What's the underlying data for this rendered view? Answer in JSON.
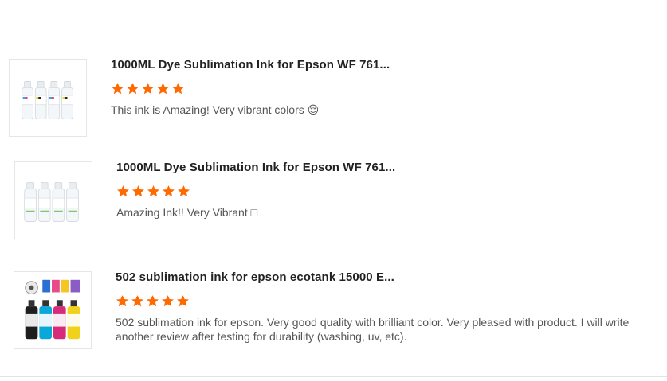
{
  "reviews": [
    {
      "title": "1000ML Dye Sublimation Ink for Epson WF 761...",
      "rating": 5,
      "text": "This ink is Amazing! Very vibrant colors 😌",
      "thumbnail": "four-white-ink-bottles"
    },
    {
      "title": "1000ML Dye Sublimation Ink for Epson WF 761...",
      "rating": 5,
      "text": "Amazing Ink!! Very Vibrant □",
      "thumbnail": "four-white-ink-bottles"
    },
    {
      "title": "502 sublimation ink for epson ecotank 15000 E...",
      "rating": 5,
      "text": "502 sublimation ink for epson. Very good quality with brilliant color. Very pleased with product. I will write another review after testing for durability (washing, uv, etc).",
      "thumbnail": "colored-ink-bottles-with-samples"
    }
  ],
  "colors": {
    "star": "#ff6a00",
    "title": "#222222",
    "text": "#555555"
  }
}
